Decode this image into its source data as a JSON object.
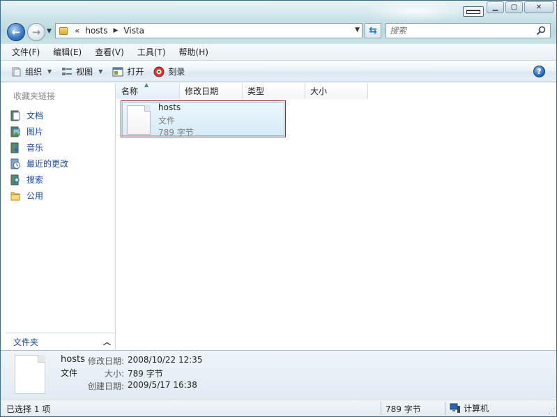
{
  "window": {
    "address": {
      "overflow_marker": "«",
      "crumbs": [
        "hosts",
        "Vista"
      ]
    },
    "search": {
      "placeholder": "搜索"
    }
  },
  "menubar": {
    "items": [
      {
        "label": "文件(F)"
      },
      {
        "label": "编辑(E)"
      },
      {
        "label": "查看(V)"
      },
      {
        "label": "工具(T)"
      },
      {
        "label": "帮助(H)"
      }
    ]
  },
  "commandbar": {
    "organize": "组织",
    "views": "视图",
    "open": "打开",
    "burn": "刻录"
  },
  "navpane": {
    "heading": "收藏夹链接",
    "links": [
      {
        "label": "文档",
        "icon": "documents-icon"
      },
      {
        "label": "图片",
        "icon": "pictures-icon"
      },
      {
        "label": "音乐",
        "icon": "music-icon"
      },
      {
        "label": "最近的更改",
        "icon": "recent-changes-icon"
      },
      {
        "label": "搜索",
        "icon": "searches-icon"
      },
      {
        "label": "公用",
        "icon": "public-folder-icon"
      }
    ],
    "folders_label": "文件夹"
  },
  "columns": [
    {
      "label": "名称",
      "sorted": true
    },
    {
      "label": "修改日期"
    },
    {
      "label": "类型"
    },
    {
      "label": "大小"
    }
  ],
  "files": [
    {
      "name": "hosts",
      "type": "文件",
      "size": "789 字节",
      "selected": true
    }
  ],
  "details": {
    "name": "hosts",
    "type": "文件",
    "modified_label": "修改日期:",
    "modified_value": "2008/10/22 12:35",
    "size_label": "大小:",
    "size_value": "789 字节",
    "created_label": "创建日期:",
    "created_value": "2009/5/17 16:38"
  },
  "statusbar": {
    "selection": "已选择 1 项",
    "size": "789 字节",
    "zone": "计算机"
  },
  "colors": {
    "selection_border": "#b3203a",
    "link": "#1a48a3",
    "glass": "#c9e3e7"
  }
}
